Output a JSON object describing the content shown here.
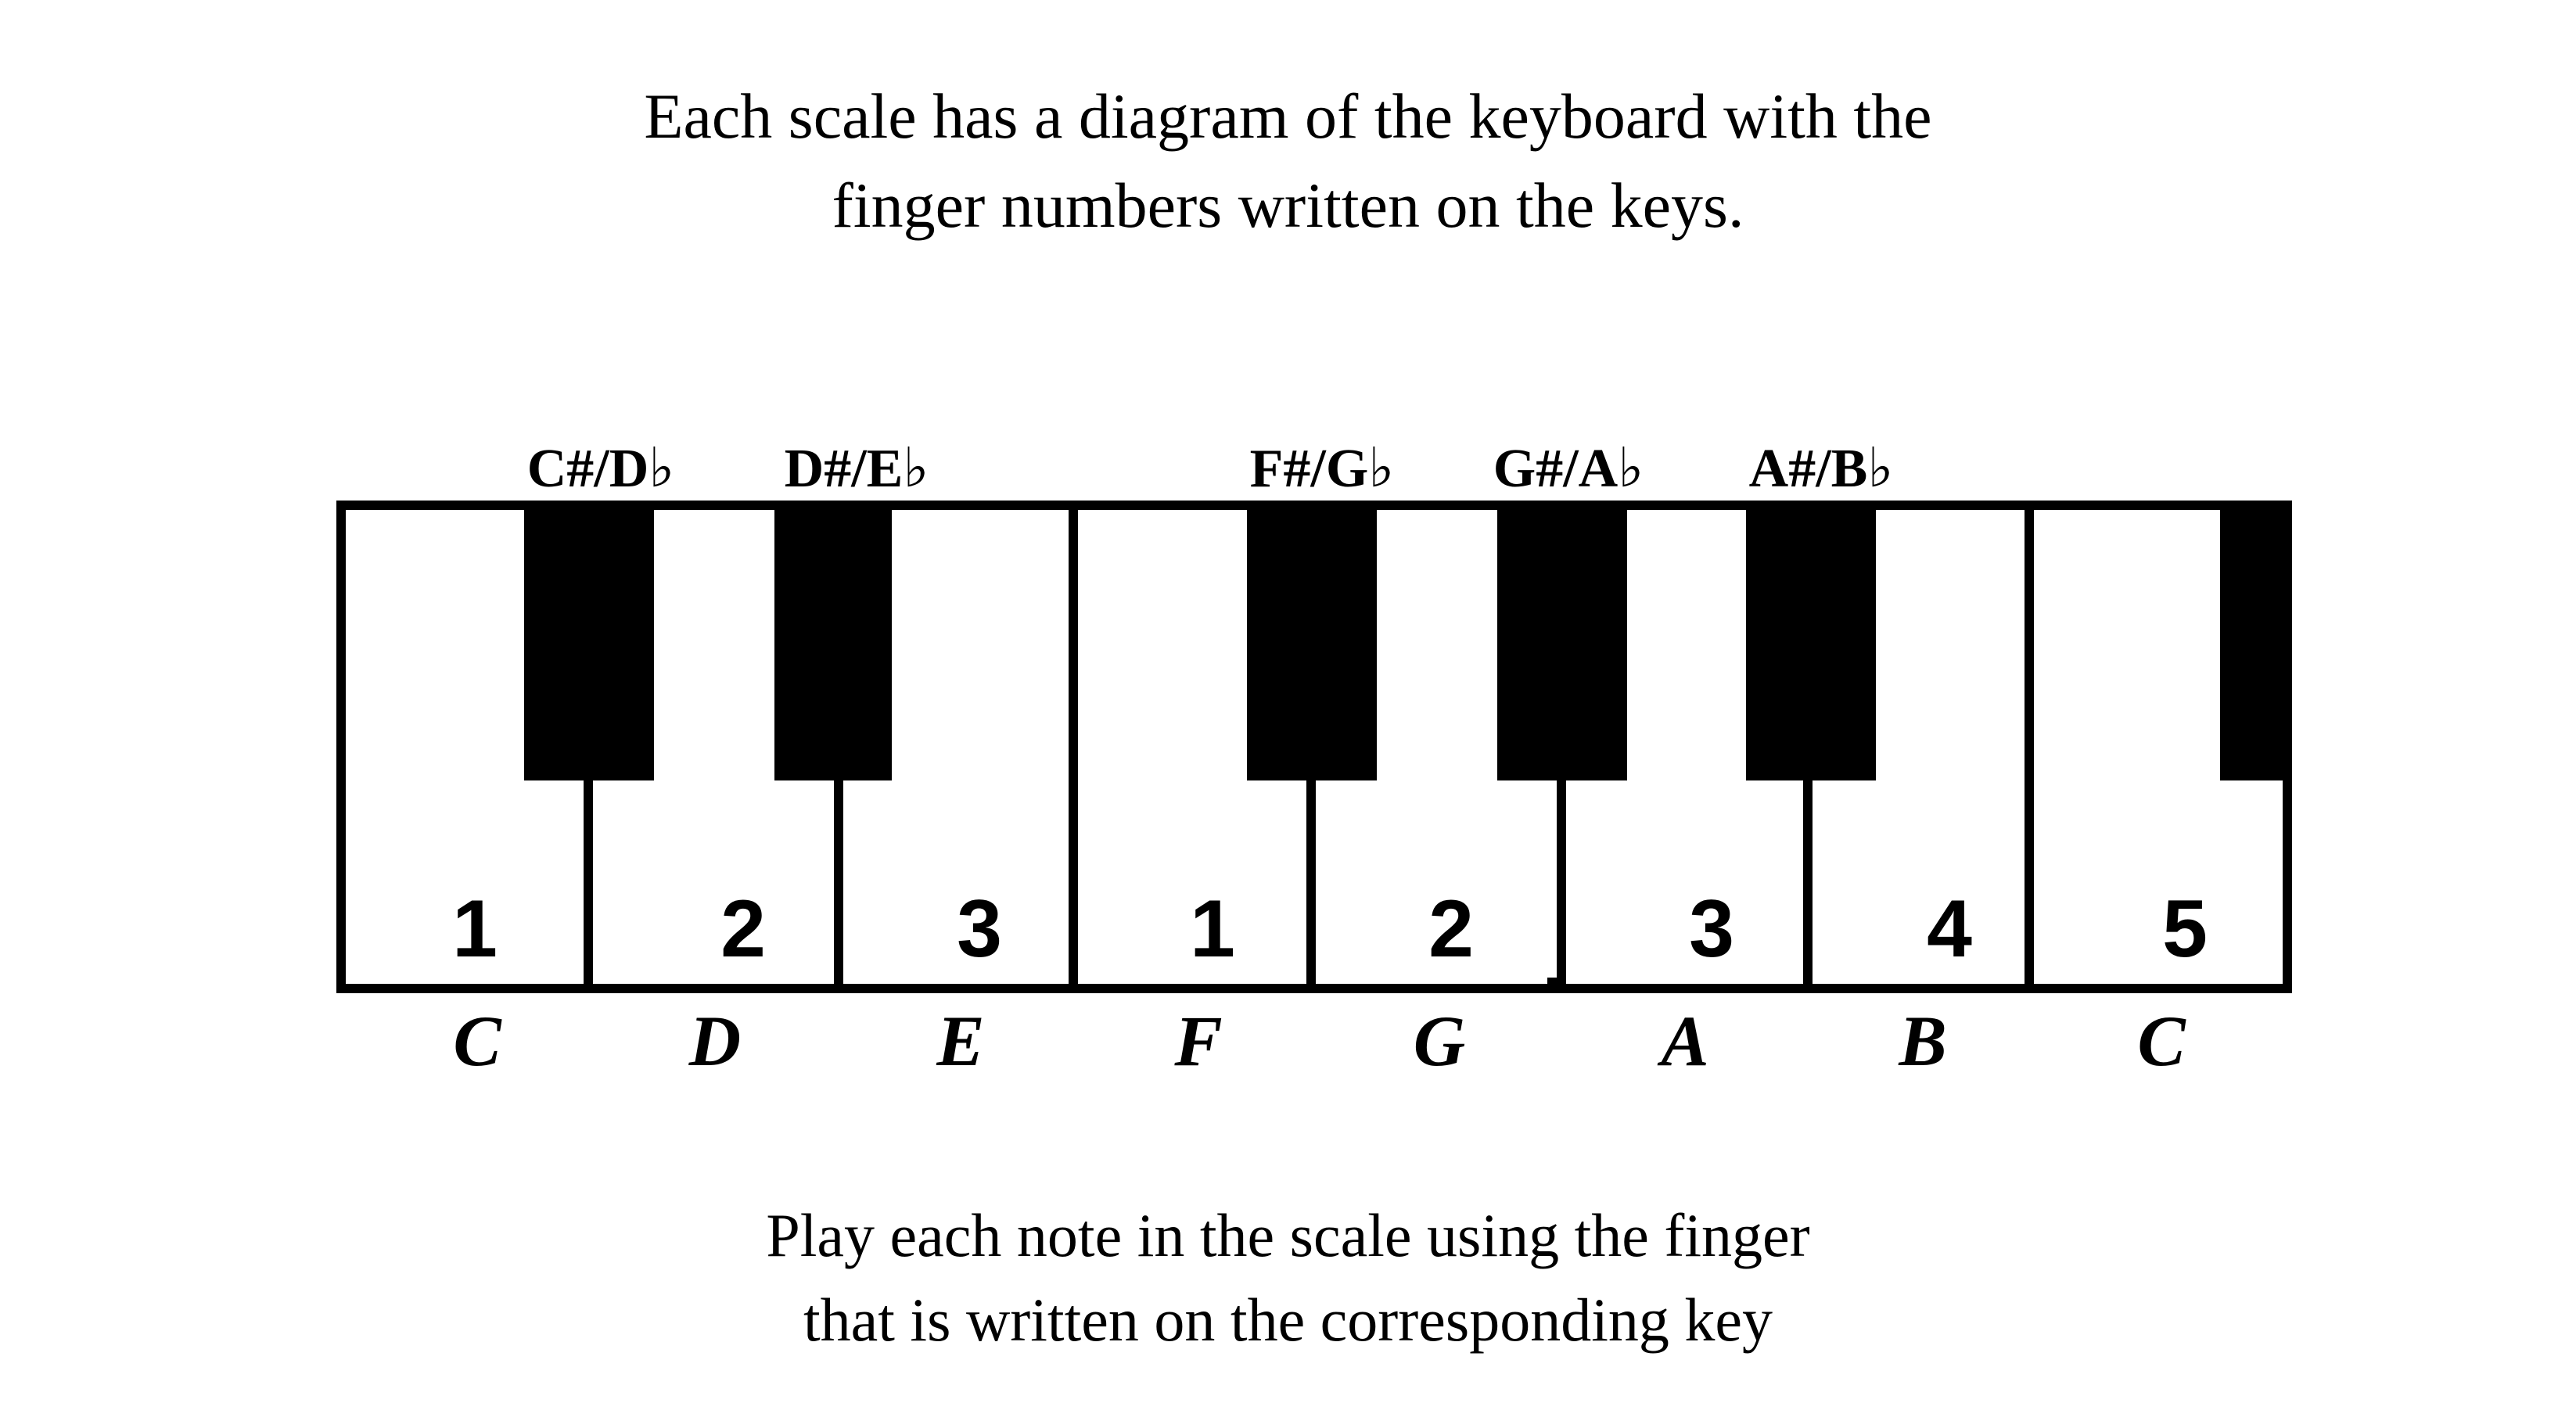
{
  "caption_top": {
    "line1": "Each scale has a diagram of the keyboard with the",
    "line2": "finger numbers written on the keys."
  },
  "keyboard": {
    "black_key_labels": [
      "C#/D♭",
      "D#/E♭",
      "F#/G♭",
      "G#/A♭",
      "A#/B♭"
    ],
    "finger_numbers": [
      "1",
      "2",
      "3",
      "1",
      "2",
      "3",
      "4",
      "5"
    ],
    "note_names": [
      "C",
      "D",
      "E",
      "F",
      "G",
      "A",
      "B",
      "C"
    ]
  },
  "caption_bottom": {
    "line1": "Play each note in the scale using the finger",
    "line2": "that is written on the corresponding key"
  }
}
